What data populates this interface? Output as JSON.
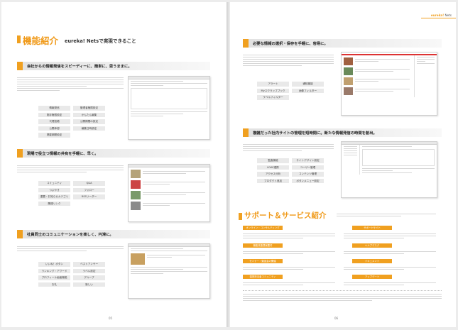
{
  "left": {
    "title": "機能紹介",
    "subtitle": "eureka! Netsで実現できること",
    "page_number": "05",
    "sections": [
      {
        "heading": "会社からの情報発信をスピーディーに、簡単に、思うままに。",
        "tags": [
          "情報発信",
          "管理者権限設定",
          "既存権限設定",
          "かんたん編集",
          "代理投稿",
          "公開期間の設定",
          "公開承認",
          "編集日時設定",
          "掲載期間設定"
        ]
      },
      {
        "heading": "現場で役立つ情報の共有を手軽に、早く。",
        "tags": [
          "コミュニティ",
          "Q&A",
          "つぶやき",
          "フォロー",
          "重要・お知らせカテゴリ",
          "RSSリーダー",
          "関連リンク"
        ]
      },
      {
        "heading": "社員同士のコミュニケーションを楽しく、円滑に。",
        "tags": [
          "いいね！ボタン",
          "ベストアンサー",
          "ランキング・アワード",
          "ラベル設定",
          "プロフィール画面機能",
          "グループ",
          "お礼",
          "新しい"
        ]
      }
    ]
  },
  "right": {
    "brand_accent": "eureka!",
    "brand_rest": "Nets",
    "page_number": "06",
    "sections": [
      {
        "heading": "必要な情報の選択・保存を手軽に、容易に。",
        "tags": [
          "アラート",
          "通知機能",
          "Myスクラップブック",
          "画像フィルター",
          "ラベルフィルター"
        ]
      },
      {
        "heading": "複雑だった社内サイトの管理を短時間に。新たな情報発信の時間を創出。",
        "tags": [
          "監査機能",
          "サイトデザイン設定",
          "LDAP連携",
          "ユーザー管理",
          "アクセス分析",
          "コンテンツ管理",
          "プロダクト追加",
          "ボタンメニュー設定"
        ]
      }
    ],
    "support": {
      "title": "サポート＆サービス紹介",
      "labels": [
        "オンライン・コンサルティング",
        "サポートサイト",
        "機能改善提案要件",
        "ヘルプデスク",
        "セミナー・勉強会の開催",
        "ドキュメント",
        "運営担当者コミュニティ",
        "アップデート"
      ]
    }
  },
  "colors": {
    "accent": "#f0a020",
    "title": "#f09a1a"
  }
}
